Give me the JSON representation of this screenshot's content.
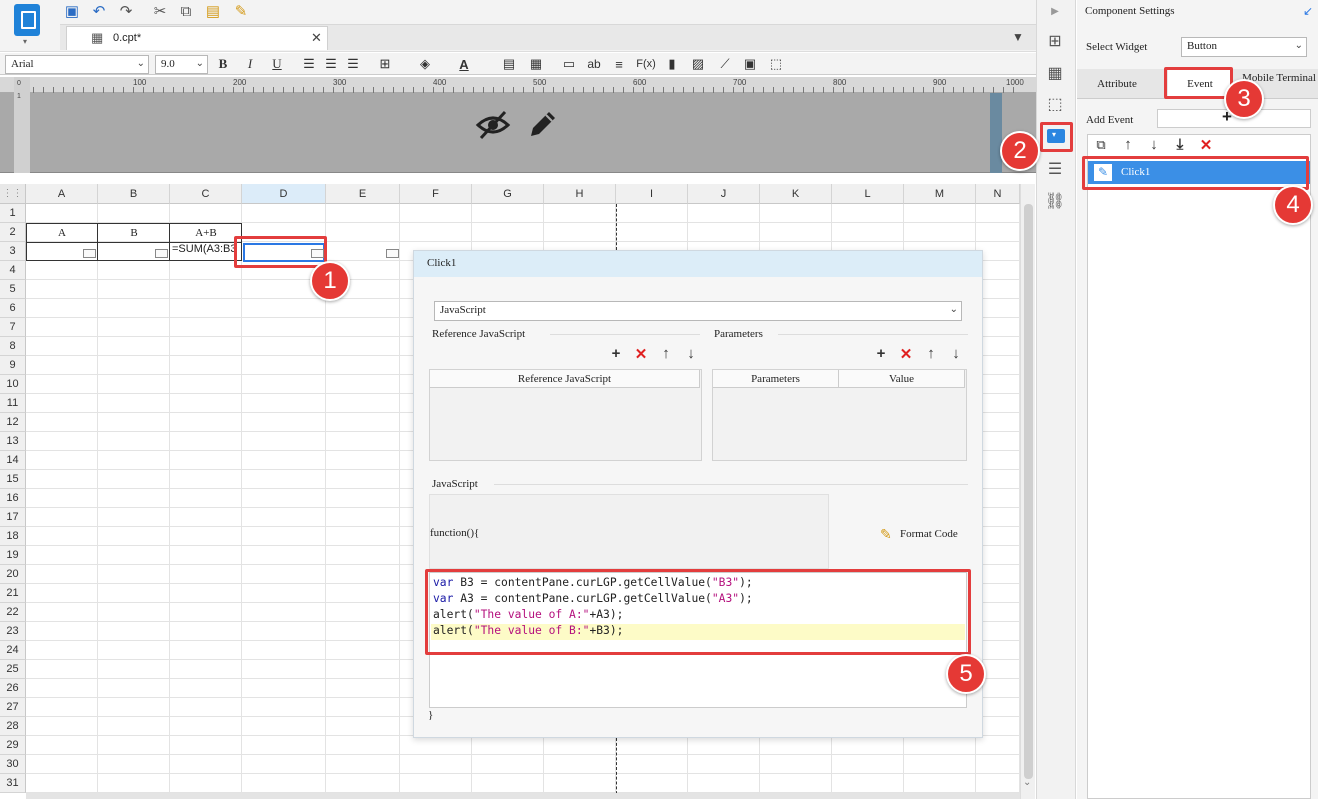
{
  "app": {
    "file_tab": "0.cpt*",
    "toolbar_font": "Arial",
    "toolbar_font_size": "9.0",
    "format_buttons": [
      "B",
      "I",
      "U"
    ],
    "text_abbr": "ab",
    "formula_abbr": "F(x)"
  },
  "ruler": {
    "ticks": [
      "100",
      "200",
      "300",
      "400",
      "500",
      "600",
      "700",
      "800",
      "900",
      "1000"
    ],
    "left_marks": [
      "0",
      "1"
    ]
  },
  "sheet": {
    "columns": [
      "A",
      "B",
      "C",
      "D",
      "E",
      "F",
      "G",
      "H",
      "I",
      "J",
      "K",
      "L",
      "M",
      "N"
    ],
    "rows": [
      "1",
      "2",
      "3",
      "4",
      "5",
      "6",
      "7",
      "8",
      "9",
      "10",
      "11",
      "12",
      "13",
      "14",
      "15",
      "16",
      "17",
      "18",
      "19",
      "20",
      "21",
      "22",
      "23",
      "24",
      "25",
      "26",
      "27",
      "28",
      "29",
      "30",
      "31"
    ],
    "cells": {
      "A2": "A",
      "B2": "B",
      "C2": "A+B",
      "C3": "=SUM(A3:B3"
    }
  },
  "right_panel": {
    "title": "Component Settings",
    "select_widget_label": "Select Widget",
    "select_widget_value": "Button",
    "tabs": [
      "Attribute",
      "Event",
      "Mobile Terminal"
    ],
    "add_event_label": "Add Event",
    "events": [
      "Click1"
    ]
  },
  "dialog": {
    "title": "Click1",
    "type_value": "JavaScript",
    "reference_label": "Reference JavaScript",
    "parameters_label": "Parameters",
    "ref_table_header": "Reference JavaScript",
    "param_table_headers": [
      "Parameters",
      "Value"
    ],
    "js_label": "JavaScript",
    "function_open": "function(){",
    "format_code": "Format Code",
    "closing_brace": "}",
    "code_lines": [
      {
        "parts": [
          {
            "t": "var",
            "c": "kw"
          },
          {
            "t": " B3 = contentPane.curLGP.getCellValue(",
            "c": ""
          },
          {
            "t": "\"B3\"",
            "c": "str"
          },
          {
            "t": ");",
            "c": ""
          }
        ]
      },
      {
        "parts": [
          {
            "t": "var",
            "c": "kw"
          },
          {
            "t": " A3 = contentPane.curLGP.getCellValue(",
            "c": ""
          },
          {
            "t": "\"A3\"",
            "c": "str"
          },
          {
            "t": ");",
            "c": ""
          }
        ]
      },
      {
        "parts": [
          {
            "t": "alert(",
            "c": ""
          },
          {
            "t": "\"The value of A:\"",
            "c": "str"
          },
          {
            "t": "+A3);",
            "c": ""
          }
        ]
      },
      {
        "parts": [
          {
            "t": "alert(",
            "c": ""
          },
          {
            "t": "\"The value of B:\"",
            "c": "str"
          },
          {
            "t": "+B3);",
            "c": ""
          }
        ]
      }
    ]
  },
  "callouts": [
    "1",
    "2",
    "3",
    "4",
    "5"
  ],
  "colors": {
    "accent": "#1f82d8",
    "callout": "#e53935",
    "selected": "#3b8fe6",
    "highlight_line": "#fdfbc7"
  }
}
